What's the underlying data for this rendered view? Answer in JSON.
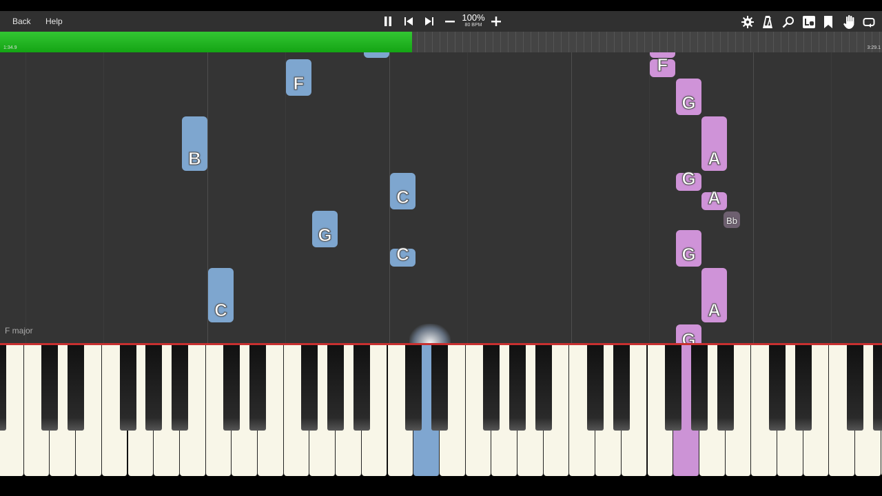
{
  "header": {
    "back_label": "Back",
    "help_label": "Help",
    "speed": "100%",
    "bpm": "80 BPM",
    "icons": [
      "pause-icon",
      "skip-back-icon",
      "skip-forward-icon",
      "minus-icon",
      "plus-icon",
      "gear-icon",
      "metronome-icon",
      "magnifier-icon",
      "note-label-icon",
      "bookmark-icon",
      "hand-icon",
      "loop-icon"
    ]
  },
  "timeline": {
    "current_time": "1:34.9",
    "total_time": "3:29.1",
    "progress_fraction": 0.467,
    "progress_color": "#22b522"
  },
  "key_signature": "F major",
  "colors": {
    "left_hand": "#7ea6cf",
    "right_hand": "#cf93d8",
    "background": "#343434"
  },
  "notes": [
    {
      "label": "F",
      "hand": "left"
    },
    {
      "label": "B",
      "hand": "left"
    },
    {
      "label": "C",
      "hand": "left"
    },
    {
      "label": "G",
      "hand": "left"
    },
    {
      "label": "C",
      "hand": "left"
    },
    {
      "label": "C",
      "hand": "left"
    },
    {
      "label": "F",
      "hand": "right"
    },
    {
      "label": "G",
      "hand": "right"
    },
    {
      "label": "A",
      "hand": "right"
    },
    {
      "label": "G",
      "hand": "right"
    },
    {
      "label": "A",
      "hand": "right"
    },
    {
      "label": "Bb",
      "hand": "right"
    },
    {
      "label": "G",
      "hand": "right"
    },
    {
      "label": "A",
      "hand": "right"
    },
    {
      "label": "G",
      "hand": "right"
    }
  ]
}
